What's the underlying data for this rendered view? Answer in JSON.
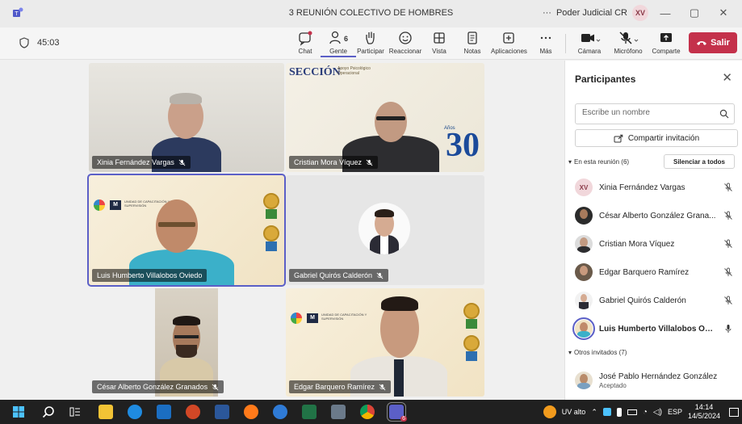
{
  "window": {
    "title": "3 REUNIÓN COLECTIVO DE HOMBRES",
    "ellipsis": "···",
    "org": "Poder Judicial CR",
    "user_initials": "XV",
    "min": "—",
    "max": "▢",
    "close": "✕"
  },
  "toolbar": {
    "timer": "45:03",
    "people_count": "6",
    "chat": "Chat",
    "people": "Gente",
    "raise": "Participar",
    "react": "Reaccionar",
    "view": "Vista",
    "notes": "Notas",
    "apps": "Aplicaciones",
    "more": "Más",
    "camera": "Cámara",
    "mic": "Micrófono",
    "share": "Comparte",
    "leave": "Salir"
  },
  "tiles": [
    {
      "name": "Xinia Fernández Vargas"
    },
    {
      "name": "Cristian Mora Víquez"
    },
    {
      "name": "Luis Humberto Villalobos Oviedo"
    },
    {
      "name": "Gabriel Quirós Calderón"
    },
    {
      "name": "César Alberto González Granados"
    },
    {
      "name": "Edgar Barquero Ramírez"
    }
  ],
  "backgrounds": {
    "seccion": "SECCIÓN",
    "seccion_sub": "Apoyo Psicológico Operacional",
    "anos": "Años",
    "anos_num": "30",
    "unidad": "UNIDAD DE CAPACITACIÓN Y SUPERVISIÓN"
  },
  "panel": {
    "title": "Participantes",
    "close": "✕",
    "search_placeholder": "Escribe un nombre",
    "share_invite": "Compartir invitación",
    "in_meeting": "En esta reunión (6)",
    "mute_all": "Silenciar a todos",
    "others": "Otros invitados (7)",
    "participants": [
      {
        "initials": "XV",
        "name": "Xinia Fernández Vargas"
      },
      {
        "name": "César Alberto González Grana..."
      },
      {
        "name": "Cristian Mora Víquez"
      },
      {
        "name": "Edgar Barquero Ramírez"
      },
      {
        "name": "Gabriel Quirós Calderón"
      },
      {
        "name": "Luis Humberto Villalobos Ovi..."
      }
    ],
    "invited": [
      {
        "name": "José Pablo Hernández González",
        "status": "Aceptado"
      }
    ]
  },
  "taskbar": {
    "teams_badge": "6",
    "weather": "UV alto",
    "lang": "ESP",
    "time": "14:14",
    "date": "14/5/2024"
  },
  "colors": {
    "accent": "#5b5fc7",
    "leave": "#c4314b"
  }
}
